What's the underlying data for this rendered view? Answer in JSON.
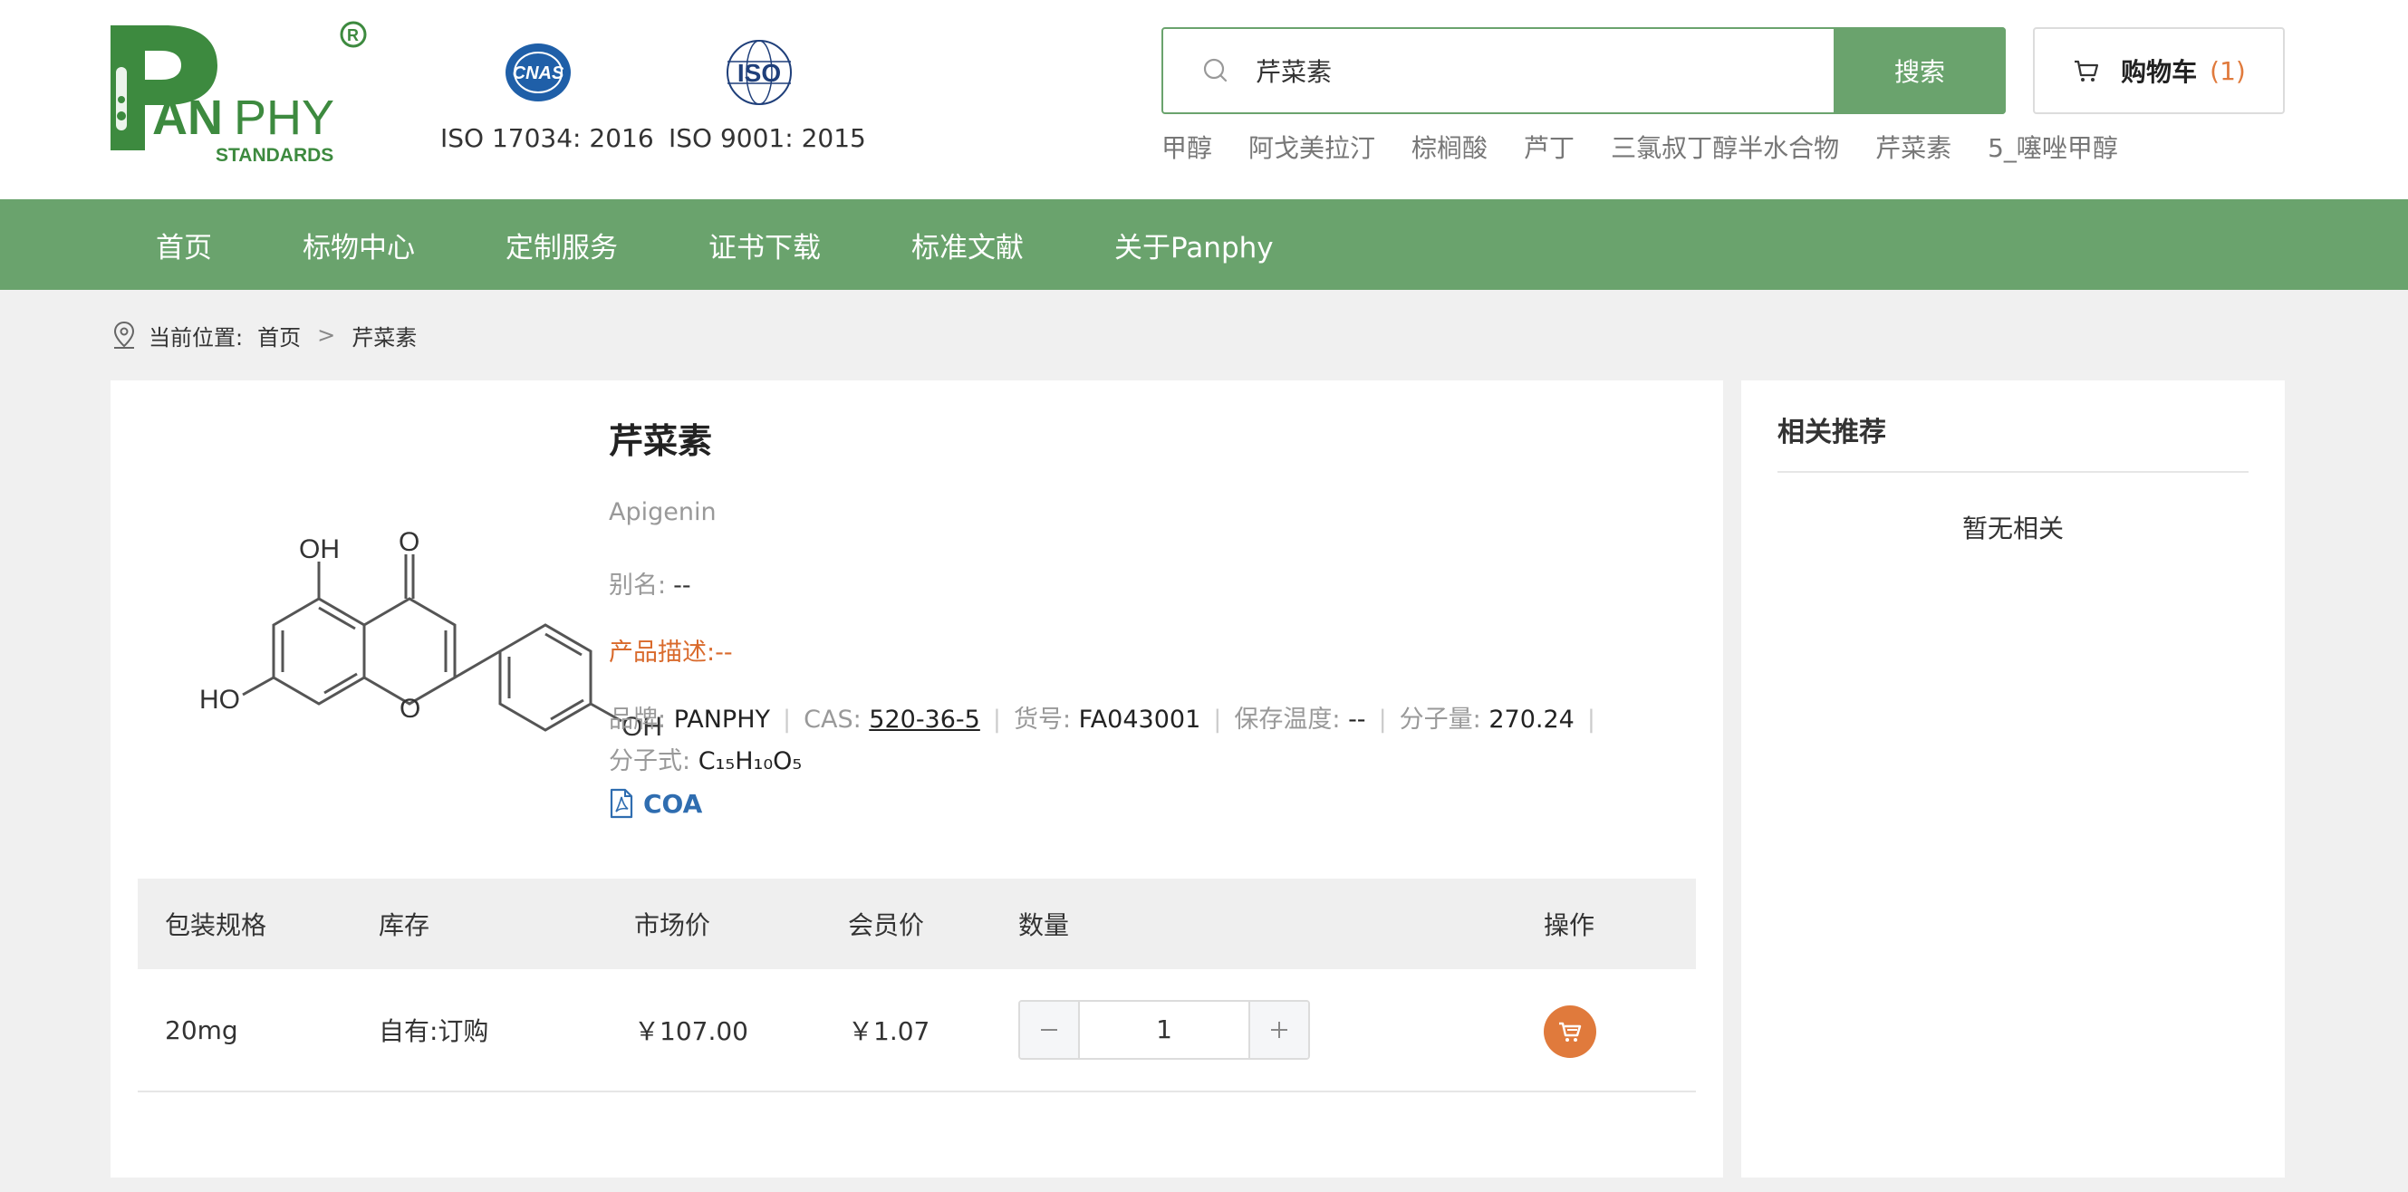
{
  "brand": {
    "logo_text_main": "PANPHY",
    "logo_text_sub": "STANDARDS",
    "registered_mark": "®",
    "accent_color": "#6aa36d"
  },
  "certs": [
    {
      "icon": "cnas-icon",
      "label": "ISO 17034: 2016"
    },
    {
      "icon": "iso-icon",
      "label": "ISO 9001: 2015"
    }
  ],
  "search": {
    "value": "芹菜素",
    "button_label": "搜索"
  },
  "cart": {
    "label": "购物车",
    "count": "(1)"
  },
  "hot_keywords": [
    "甲醇",
    "阿戈美拉汀",
    "棕榈酸",
    "芦丁",
    "三氯叔丁醇半水合物",
    "芹菜素",
    "5_噻唑甲醇"
  ],
  "nav": {
    "items": [
      "首页",
      "标物中心",
      "定制服务",
      "证书下载",
      "标准文献",
      "关于Panphy"
    ]
  },
  "breadcrumb": {
    "prefix": "当前位置:",
    "home": "首页",
    "separator": ">",
    "current": "芹菜素"
  },
  "product": {
    "name": "芹菜素",
    "name_en": "Apigenin",
    "alias_label": "别名:",
    "alias_value": "--",
    "desc_label": "产品描述:",
    "desc_value": "--",
    "brand_label": "品牌:",
    "brand_value": "PANPHY",
    "cas_label": "CAS:",
    "cas_value": "520-36-5",
    "sku_label": "货号:",
    "sku_value": "FA043001",
    "storage_label": "保存温度:",
    "storage_value": "--",
    "mw_label": "分子量:",
    "mw_value": "270.24",
    "formula_label": "分子式:",
    "formula_value": "C₁₅H₁₀O₅",
    "coa_label": "COA",
    "structure_labels": {
      "oh_top": "OH",
      "o_top": "O",
      "ho_left": "HO",
      "o_ring": "O",
      "oh_right": "OH"
    }
  },
  "table": {
    "headers": [
      "包装规格",
      "库存",
      "市场价",
      "会员价",
      "数量",
      "操作"
    ],
    "rows": [
      {
        "spec": "20mg",
        "stock": "自有:订购",
        "market_price": "￥107.00",
        "member_price": "￥1.07",
        "quantity": "1"
      }
    ]
  },
  "related": {
    "title": "相关推荐",
    "empty": "暂无相关"
  }
}
